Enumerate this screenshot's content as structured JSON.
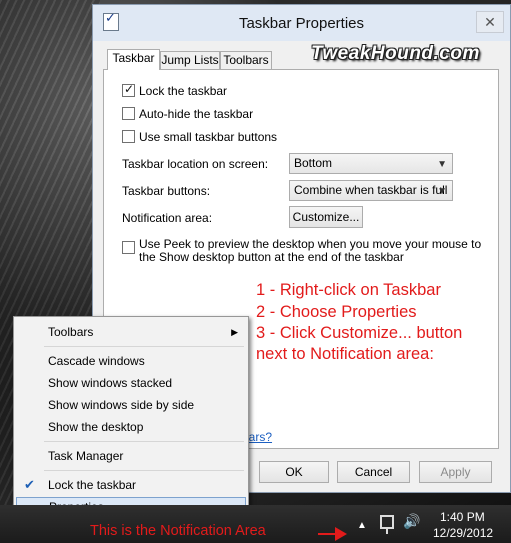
{
  "dialog": {
    "title": "Taskbar Properties",
    "close_glyph": "✕",
    "watermark": "TweakHound.com",
    "tabs": [
      {
        "label": "Taskbar"
      },
      {
        "label": "Jump Lists"
      },
      {
        "label": "Toolbars"
      }
    ],
    "options": {
      "lock": {
        "label": "Lock the taskbar",
        "checked": true
      },
      "autohide": {
        "label": "Auto-hide the taskbar",
        "checked": false
      },
      "small": {
        "label": "Use small taskbar buttons",
        "checked": false
      },
      "peek": {
        "label": "Use Peek to preview the desktop when you move your mouse to the Show desktop button at the end of the taskbar",
        "checked": false
      }
    },
    "location": {
      "label": "Taskbar location on screen:",
      "value": "Bottom"
    },
    "buttons_setting": {
      "label": "Taskbar buttons:",
      "value": "Combine when taskbar is full"
    },
    "notification": {
      "label": "Notification area:",
      "button": "Customize..."
    },
    "help_link": "bars?",
    "footer": {
      "ok": "OK",
      "cancel": "Cancel",
      "apply": "Apply"
    }
  },
  "annotation": {
    "lines": [
      "1 - Right-click on Taskbar",
      "2 - Choose Properties",
      "3 - Click Customize... button",
      "next to Notification area:"
    ],
    "notification_callout": "This is the Notification Area"
  },
  "context_menu": {
    "items": [
      {
        "label": "Toolbars",
        "submenu": true
      },
      {
        "label": "Cascade windows"
      },
      {
        "label": "Show windows stacked"
      },
      {
        "label": "Show windows side by side"
      },
      {
        "label": "Show the desktop"
      },
      {
        "label": "Task Manager"
      },
      {
        "label": "Lock the taskbar",
        "checked": true
      },
      {
        "label": "Properties",
        "highlighted": true
      }
    ]
  },
  "taskbar": {
    "clock_time": "1:40 PM",
    "clock_date": "12/29/2012",
    "tray_icons": [
      "chevron-up-icon",
      "network-icon",
      "volume-icon"
    ]
  },
  "colors": {
    "annotation": "#e21b1b",
    "link": "#1c5fc1",
    "menu_highlight": "#dce8f7"
  }
}
